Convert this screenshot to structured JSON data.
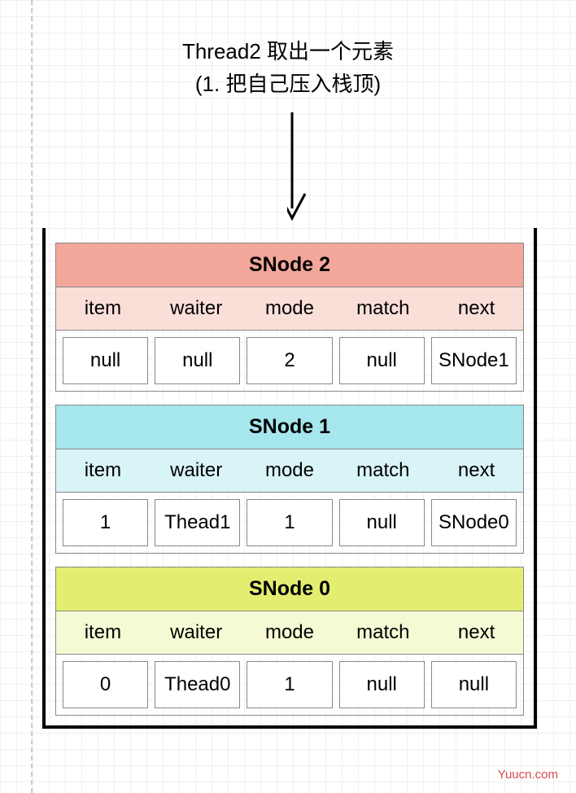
{
  "caption_line1": "Thread2 取出一个元素",
  "caption_line2": "(1. 把自己压入栈顶)",
  "fields": [
    "item",
    "waiter",
    "mode",
    "match",
    "next"
  ],
  "nodes": [
    {
      "title": "SNode 2",
      "title_class": "c2-title",
      "fields_class": "c2-fields",
      "values": [
        "null",
        "null",
        "2",
        "null",
        "SNode1"
      ]
    },
    {
      "title": "SNode 1",
      "title_class": "c1-title",
      "fields_class": "c1-fields",
      "values": [
        "1",
        "Thead1",
        "1",
        "null",
        "SNode0"
      ]
    },
    {
      "title": "SNode 0",
      "title_class": "c0-title",
      "fields_class": "c0-fields",
      "values": [
        "0",
        "Thead0",
        "1",
        "null",
        "null"
      ]
    }
  ],
  "watermark": "Yuucn.com"
}
